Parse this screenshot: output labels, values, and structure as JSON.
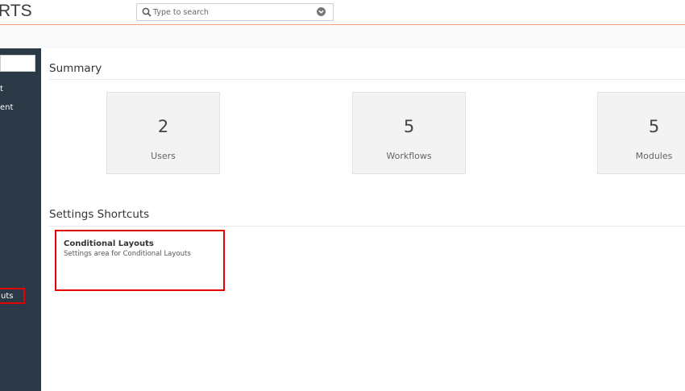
{
  "header": {
    "brand": "RTS",
    "search_placeholder": "Type to search"
  },
  "sidebar": {
    "items": [
      {
        "label": "t"
      },
      {
        "label": "ent"
      },
      {
        "label": "uts"
      }
    ]
  },
  "summary": {
    "title": "Summary",
    "stats": [
      {
        "value": "2",
        "label": "Users"
      },
      {
        "value": "5",
        "label": "Workflows"
      },
      {
        "value": "5",
        "label": "Modules"
      }
    ]
  },
  "shortcuts": {
    "title": "Settings Shortcuts",
    "items": [
      {
        "title": "Conditional Layouts",
        "description": "Settings area for Conditional Layouts"
      }
    ]
  },
  "colors": {
    "accent": "#f0a47a",
    "sidebar": "#2b3947",
    "highlight": "#e60000"
  }
}
